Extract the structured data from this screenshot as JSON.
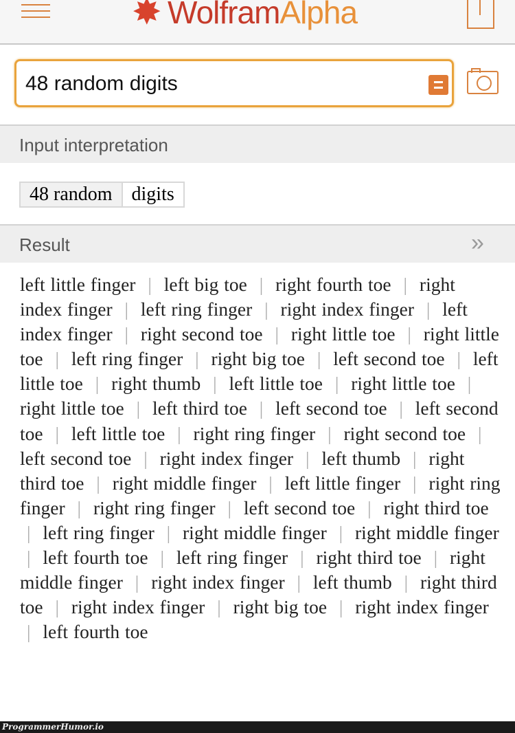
{
  "header": {
    "logo_primary": "Wolfram",
    "logo_secondary": "Alpha",
    "registered": "®",
    "brand_colors": {
      "red": "#c53b2a",
      "orange": "#e8913a"
    }
  },
  "search": {
    "value": "48 random digits",
    "equals_icon": "equals-icon",
    "camera_icon": "camera-icon"
  },
  "input_interpretation": {
    "title": "Input interpretation",
    "parts": [
      "48 random",
      "digits"
    ]
  },
  "result": {
    "title": "Result",
    "separator": "|",
    "items": [
      "left little finger",
      "left big toe",
      "right fourth toe",
      "right index finger",
      "left ring finger",
      "right index finger",
      "left index finger",
      "right second toe",
      "right little toe",
      "right little toe",
      "left ring finger",
      "right big toe",
      "left second toe",
      "left little toe",
      "right thumb",
      "left little toe",
      "right little toe",
      "right little toe",
      "left third toe",
      "left second toe",
      "left second toe",
      "left little toe",
      "right ring finger",
      "right second toe",
      "left second toe",
      "right index finger",
      "left thumb",
      "right third toe",
      "right middle finger",
      "left little finger",
      "right ring finger",
      "right ring finger",
      "left second toe",
      "right third toe",
      "left ring finger",
      "right middle finger",
      "right middle finger",
      "left fourth toe",
      "left ring finger",
      "right third toe",
      "right middle finger",
      "right index finger",
      "left thumb",
      "right third toe",
      "right index finger",
      "right big toe",
      "right index finger",
      "left fourth toe"
    ]
  },
  "footer": {
    "watermark": "ProgrammerHumor.io"
  }
}
